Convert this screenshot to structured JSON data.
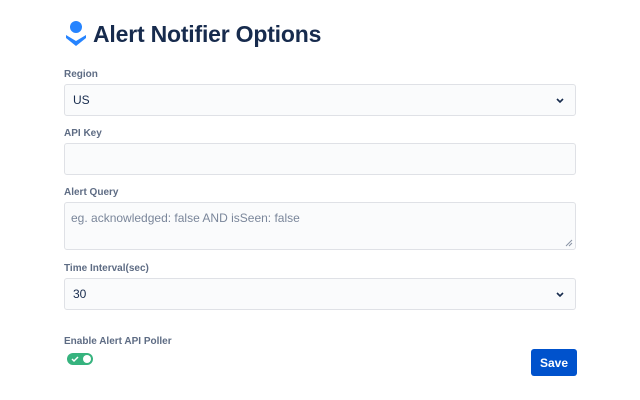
{
  "header": {
    "title": "Alert Notifier Options",
    "logo_icon": "opsgenie-logo-icon",
    "brand_color": "#2684ff"
  },
  "form": {
    "region": {
      "label": "Region",
      "value": "US",
      "icon": "chevron-down-icon"
    },
    "api_key": {
      "label": "API Key",
      "value": ""
    },
    "alert_query": {
      "label": "Alert Query",
      "value": "",
      "placeholder": "eg. acknowledged: false AND isSeen: false"
    },
    "time_interval": {
      "label": "Time Interval(sec)",
      "value": "30",
      "icon": "chevron-down-icon"
    },
    "poller": {
      "label": "Enable Alert API Poller",
      "enabled": true,
      "toggle_color": "#36b37e"
    },
    "save_label": "Save",
    "save_color": "#0052cc"
  }
}
